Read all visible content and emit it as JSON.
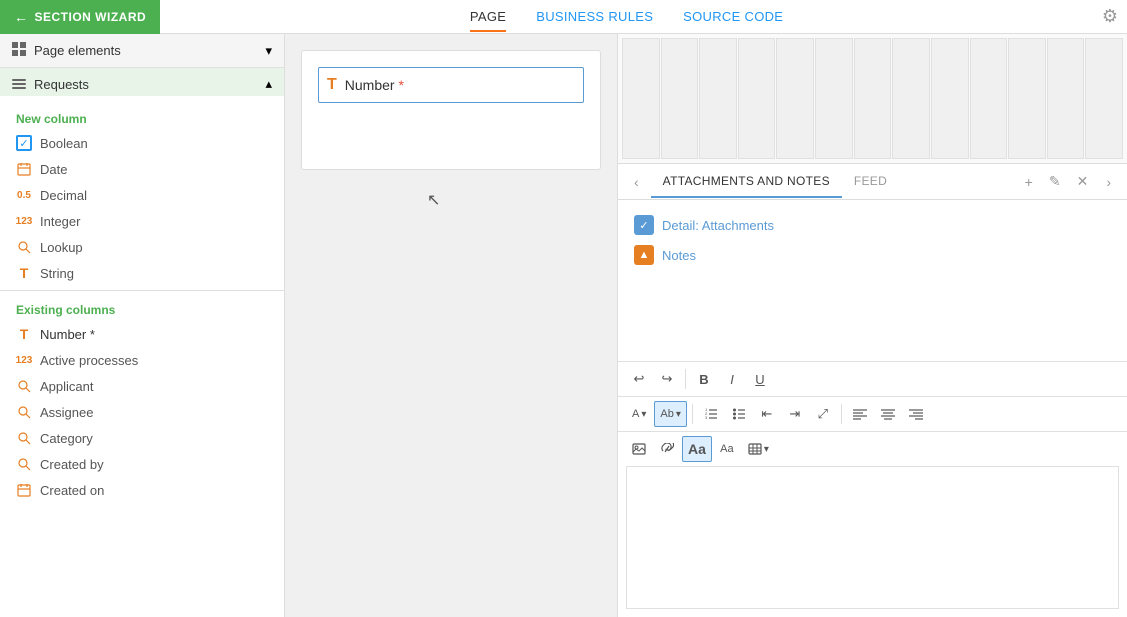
{
  "topNav": {
    "wizardBtn": "SECTION WIZARD",
    "tabs": [
      {
        "id": "page",
        "label": "PAGE",
        "active": true
      },
      {
        "id": "business-rules",
        "label": "BUSINESS RULES",
        "active": false
      },
      {
        "id": "source-code",
        "label": "SOURCE CODE",
        "active": false
      }
    ]
  },
  "sidebar": {
    "pageElements": {
      "label": "Page elements",
      "chevron": "▾"
    },
    "requests": {
      "label": "Requests",
      "chevron": "▴"
    },
    "newColumns": {
      "label": "New column",
      "items": [
        {
          "id": "boolean",
          "label": "Boolean",
          "iconType": "checkbox"
        },
        {
          "id": "date",
          "label": "Date",
          "iconType": "calendar"
        },
        {
          "id": "decimal",
          "label": "Decimal",
          "iconType": "decimal"
        },
        {
          "id": "integer",
          "label": "Integer",
          "iconType": "integer"
        },
        {
          "id": "lookup",
          "label": "Lookup",
          "iconType": "lookup"
        },
        {
          "id": "string",
          "label": "String",
          "iconType": "string"
        }
      ]
    },
    "existingColumns": {
      "label": "Existing columns",
      "items": [
        {
          "id": "number",
          "label": "Number *",
          "iconType": "string",
          "required": true
        },
        {
          "id": "active-processes",
          "label": "Active processes",
          "iconType": "integer"
        },
        {
          "id": "applicant",
          "label": "Applicant",
          "iconType": "lookup"
        },
        {
          "id": "assignee",
          "label": "Assignee",
          "iconType": "lookup"
        },
        {
          "id": "category",
          "label": "Category",
          "iconType": "lookup"
        },
        {
          "id": "created-by",
          "label": "Created by",
          "iconType": "lookup"
        },
        {
          "id": "created-on",
          "label": "Created on",
          "iconType": "calendar"
        }
      ]
    }
  },
  "canvas": {
    "field": {
      "icon": "T",
      "label": "Number",
      "required": true
    }
  },
  "rightPanel": {
    "attachmentsTabs": [
      {
        "id": "attachments-notes",
        "label": "ATTACHMENTS AND NOTES",
        "active": true
      },
      {
        "id": "feed",
        "label": "FEED",
        "active": false
      }
    ],
    "actions": {
      "add": "+",
      "edit": "✎",
      "close": "✕"
    },
    "items": [
      {
        "id": "detail-attachments",
        "label": "Detail: Attachments",
        "iconType": "blue-bg",
        "icon": "✓"
      },
      {
        "id": "notes",
        "label": "Notes",
        "iconType": "orange-bg",
        "icon": "▲"
      }
    ],
    "toolbar": {
      "rows": [
        {
          "buttons": [
            {
              "id": "undo",
              "label": "↩",
              "title": "Undo"
            },
            {
              "id": "redo",
              "label": "↪",
              "title": "Redo"
            },
            {
              "id": "bold",
              "label": "B",
              "title": "Bold",
              "bold": true
            },
            {
              "id": "italic",
              "label": "I",
              "title": "Italic",
              "italic": true
            },
            {
              "id": "underline",
              "label": "U",
              "title": "Underline",
              "underline": true
            }
          ]
        },
        {
          "buttons": [
            {
              "id": "font-color",
              "label": "A▾",
              "title": "Font Color",
              "hasArrow": true
            },
            {
              "id": "highlight",
              "label": "Ab▾",
              "title": "Highlight",
              "hasArrow": true,
              "active": true
            },
            {
              "id": "ordered-list",
              "label": "≡",
              "title": "Ordered List"
            },
            {
              "id": "unordered-list",
              "label": "≡",
              "title": "Unordered List"
            },
            {
              "id": "decrease-indent",
              "label": "⇤",
              "title": "Decrease Indent"
            },
            {
              "id": "increase-indent",
              "label": "⇥",
              "title": "Increase Indent"
            },
            {
              "id": "expand",
              "label": "⤢",
              "title": "Expand"
            },
            {
              "id": "align-left",
              "label": "≡",
              "title": "Align Left"
            },
            {
              "id": "align-center",
              "label": "≡",
              "title": "Align Center"
            },
            {
              "id": "align-right",
              "label": "≡",
              "title": "Align Right"
            }
          ]
        },
        {
          "buttons": [
            {
              "id": "image",
              "label": "🖼",
              "title": "Insert Image"
            },
            {
              "id": "link",
              "label": "🔗",
              "title": "Insert Link"
            },
            {
              "id": "font-size-large",
              "label": "Aa",
              "title": "Font Size Large",
              "active": true
            },
            {
              "id": "font-size-small",
              "label": "Aa",
              "title": "Font Size Small"
            },
            {
              "id": "table",
              "label": "⊞▾",
              "title": "Insert Table",
              "hasArrow": true
            }
          ]
        }
      ]
    }
  }
}
